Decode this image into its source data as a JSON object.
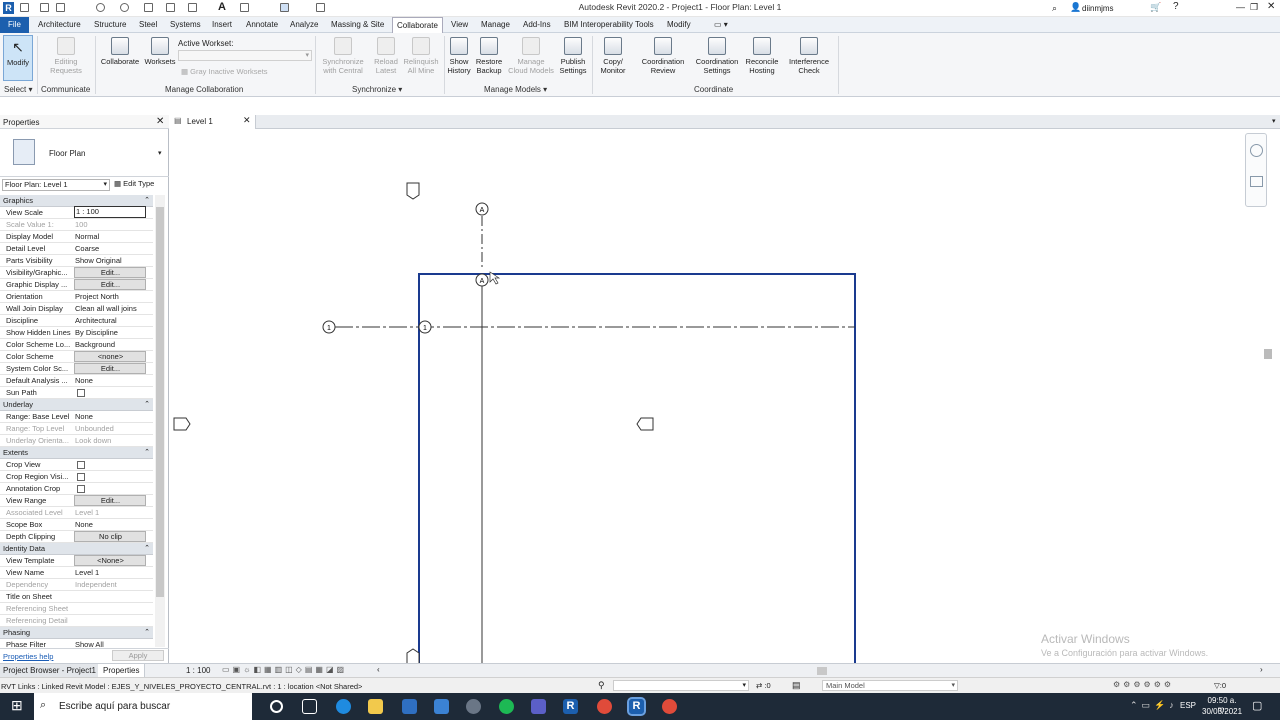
{
  "app": {
    "title": "Autodesk Revit 2020.2 - Project1 - Floor Plan: Level 1",
    "user": "diinmjms"
  },
  "tabs": [
    "File",
    "Architecture",
    "Structure",
    "Steel",
    "Systems",
    "Insert",
    "Annotate",
    "Analyze",
    "Massing & Site",
    "Collaborate",
    "View",
    "Manage",
    "Add-Ins",
    "BIM Interoperability Tools",
    "Modify"
  ],
  "ribbon": {
    "modify": "Modify",
    "select": "Select",
    "active_workset_label": "Active Workset:",
    "gray_inactive": "Gray Inactive Worksets",
    "buttons": [
      {
        "l1": "Editing",
        "l2": "Requests",
        "dis": true
      },
      {
        "l1": "Collaborate",
        "l2": "",
        "dis": false
      },
      {
        "l1": "Worksets",
        "l2": "",
        "dis": false
      },
      {
        "l1": "Synchronize",
        "l2": "with Central",
        "dis": true
      },
      {
        "l1": "Reload",
        "l2": "Latest",
        "dis": true
      },
      {
        "l1": "Relinquish",
        "l2": "All Mine",
        "dis": true
      },
      {
        "l1": "Show",
        "l2": "History",
        "dis": false
      },
      {
        "l1": "Restore",
        "l2": "Backup",
        "dis": false
      },
      {
        "l1": "Manage",
        "l2": "Cloud Models",
        "dis": true
      },
      {
        "l1": "Publish",
        "l2": "Settings",
        "dis": false
      },
      {
        "l1": "Copy/",
        "l2": "Monitor",
        "dis": false
      },
      {
        "l1": "Coordination",
        "l2": "Review",
        "dis": false
      },
      {
        "l1": "Coordination",
        "l2": "Settings",
        "dis": false
      },
      {
        "l1": "Reconcile",
        "l2": "Hosting",
        "dis": false
      },
      {
        "l1": "Interference",
        "l2": "Check",
        "dis": false
      }
    ],
    "groups": {
      "communicate": "Communicate",
      "manage_collab": "Manage Collaboration",
      "synchronize": "Synchronize",
      "manage_models": "Manage Models",
      "coordinate": "Coordinate"
    }
  },
  "properties": {
    "title": "Properties",
    "type": "Floor Plan",
    "selector": "Floor Plan: Level 1",
    "edit_type": "Edit Type",
    "help": "Properties help",
    "apply": "Apply",
    "rows": [
      {
        "s": "Graphics"
      },
      {
        "k": "View Scale",
        "v": "1 : 100",
        "box": true
      },
      {
        "k": "Scale Value    1:",
        "v": "100",
        "dim": true
      },
      {
        "k": "Display Model",
        "v": "Normal"
      },
      {
        "k": "Detail Level",
        "v": "Coarse"
      },
      {
        "k": "Parts Visibility",
        "v": "Show Original"
      },
      {
        "k": "Visibility/Graphic...",
        "v": "Edit...",
        "btn": true
      },
      {
        "k": "Graphic Display ...",
        "v": "Edit...",
        "btn": true
      },
      {
        "k": "Orientation",
        "v": "Project North"
      },
      {
        "k": "Wall Join Display",
        "v": "Clean all wall joins"
      },
      {
        "k": "Discipline",
        "v": "Architectural"
      },
      {
        "k": "Show Hidden Lines",
        "v": "By Discipline"
      },
      {
        "k": "Color Scheme Lo...",
        "v": "Background"
      },
      {
        "k": "Color Scheme",
        "v": "<none>",
        "btn": true
      },
      {
        "k": "System Color Sc...",
        "v": "Edit...",
        "btn": true
      },
      {
        "k": "Default Analysis ...",
        "v": "None"
      },
      {
        "k": "Sun Path",
        "v": "",
        "chk": true
      },
      {
        "s": "Underlay"
      },
      {
        "k": "Range: Base Level",
        "v": "None"
      },
      {
        "k": "Range: Top Level",
        "v": "Unbounded",
        "dim": true
      },
      {
        "k": "Underlay Orienta...",
        "v": "Look down",
        "dim": true
      },
      {
        "s": "Extents"
      },
      {
        "k": "Crop View",
        "v": "",
        "chk": true
      },
      {
        "k": "Crop Region Visi...",
        "v": "",
        "chk": true
      },
      {
        "k": "Annotation Crop",
        "v": "",
        "chk": true
      },
      {
        "k": "View Range",
        "v": "Edit...",
        "btn": true
      },
      {
        "k": "Associated Level",
        "v": "Level 1",
        "dim": true
      },
      {
        "k": "Scope Box",
        "v": "None"
      },
      {
        "k": "Depth Clipping",
        "v": "No clip",
        "btn": true
      },
      {
        "s": "Identity Data"
      },
      {
        "k": "View Template",
        "v": "<None>",
        "btn": true
      },
      {
        "k": "View Name",
        "v": "Level 1"
      },
      {
        "k": "Dependency",
        "v": "Independent",
        "dim": true
      },
      {
        "k": "Title on Sheet",
        "v": ""
      },
      {
        "k": "Referencing Sheet",
        "v": "",
        "dim": true
      },
      {
        "k": "Referencing Detail",
        "v": "",
        "dim": true
      },
      {
        "s": "Phasing"
      },
      {
        "k": "Phase Filter",
        "v": "Show All"
      }
    ]
  },
  "view_tab": "Level 1",
  "grid": {
    "a": "A",
    "one": "1"
  },
  "bottom": {
    "browser": "Project Browser - Project1",
    "properties": "Properties",
    "scale": "1 : 100"
  },
  "status": {
    "text": "RVT Links : Linked Revit Model : EJES_Y_NIVELES_PROYECTO_CENTRAL.rvt : 1 : location <Not Shared>",
    "zero": ":0",
    "model": "Main Model"
  },
  "watermark": {
    "l1": "Activar Windows",
    "l2": "Ve a Configuración para activar Windows."
  },
  "taskbar": {
    "search": "Escribe aquí para buscar",
    "lang": "ESP",
    "time": "09:50 a. m.",
    "date": "30/03/2021"
  }
}
